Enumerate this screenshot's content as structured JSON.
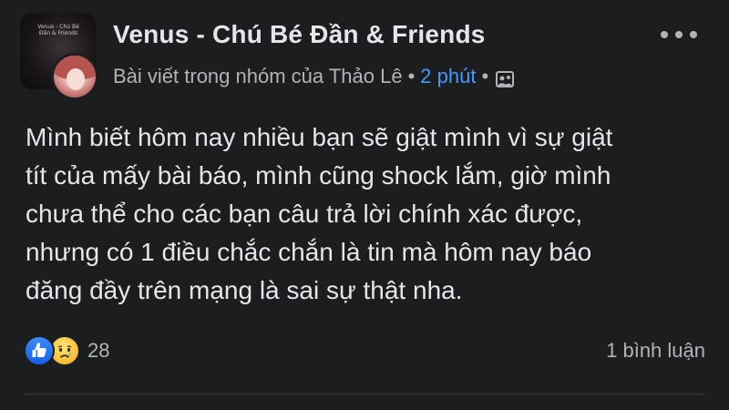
{
  "post": {
    "group_name": "Venus - Chú Bé Đần & Friends",
    "subtitle_prefix": "Bài viết trong nhóm của Thảo Lê",
    "separator": "•",
    "time": "2 phút",
    "privacy_icon": "group-privacy-icon",
    "group_avatar_text": "Venus - Chú Bé Đần & Friends",
    "body_lines": [
      "Mình biết hôm nay nhiều bạn sẽ giật mình vì sự giật",
      "tít của mấy bài báo, mình cũng shock lắm, giờ mình",
      "chưa thể cho các bạn câu trả lời chính xác được,",
      "nhưng có 1 điều chắc chắn là tin mà hôm nay báo",
      "đăng đầy trên mạng là sai sự thật nha."
    ],
    "reactions": {
      "icons": [
        "like-icon",
        "sad-icon"
      ],
      "count": "28"
    },
    "comments": "1 bình luận"
  },
  "colors": {
    "background": "#1c1d1f",
    "text_primary": "#e4e6eb",
    "text_secondary": "#b0b3b8",
    "link_blue": "#4599ff",
    "like_blue": "#1877f2",
    "sad_yellow": "#f8c33a"
  }
}
